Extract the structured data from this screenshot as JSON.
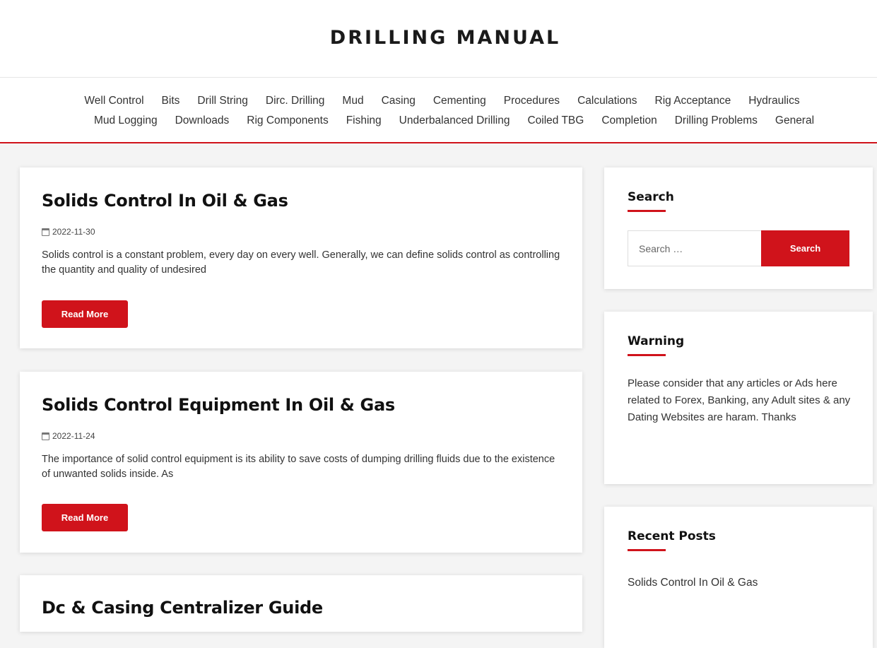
{
  "site": {
    "title": "DRILLING MANUAL"
  },
  "nav": {
    "row1": [
      "Well Control",
      "Bits",
      "Drill String",
      "Dirc. Drilling",
      "Mud",
      "Casing",
      "Cementing",
      "Procedures",
      "Calculations",
      "Rig Acceptance",
      "Hydraulics"
    ],
    "row2": [
      "Mud Logging",
      "Downloads",
      "Rig Components",
      "Fishing",
      "Underbalanced Drilling",
      "Coiled TBG",
      "Completion",
      "Drilling Problems",
      "General"
    ]
  },
  "posts": [
    {
      "title": "Solids Control In Oil & Gas",
      "date": "2022-11-30",
      "excerpt": "Solids control is a constant problem, every day on every well. Generally, we can define solids control as controlling the quantity and quality of undesired",
      "read_more": "Read More"
    },
    {
      "title": "Solids Control Equipment In Oil & Gas",
      "date": "2022-11-24",
      "excerpt": "The importance of solid control equipment is its ability to save costs of dumping drilling fluids due to the existence of unwanted solids inside. As",
      "read_more": "Read More"
    },
    {
      "title": "Dc & Casing Centralizer Guide"
    }
  ],
  "sidebar": {
    "search": {
      "title": "Search",
      "placeholder": "Search …",
      "button": "Search"
    },
    "warning": {
      "title": "Warning",
      "text": "Please consider that any articles or Ads here related to Forex, Banking, any Adult sites & any Dating Websites are haram. Thanks"
    },
    "recent": {
      "title": "Recent Posts",
      "items": [
        "Solids Control In Oil & Gas"
      ]
    }
  },
  "colors": {
    "accent": "#d0131b"
  }
}
